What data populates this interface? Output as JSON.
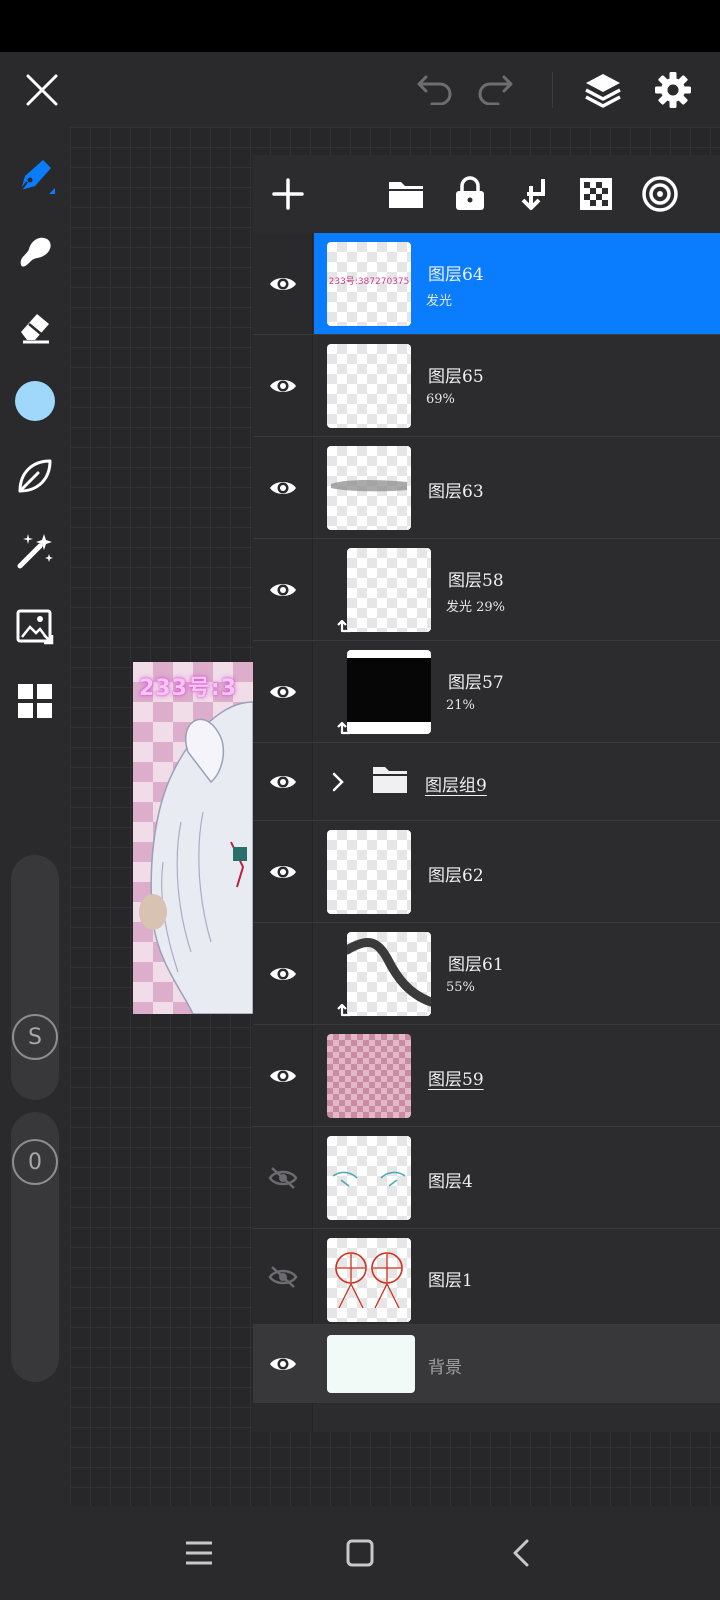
{
  "top_bar": {
    "close_icon": "close-icon",
    "undo_icon": "undo-icon",
    "redo_icon": "redo-icon",
    "layers_icon": "layers-icon",
    "settings_icon": "gear-icon"
  },
  "tools": [
    "pen-icon",
    "smudge-icon",
    "eraser-icon",
    "color-swatch",
    "leaf-icon",
    "magic-wand-icon",
    "image-import-icon",
    "grid-icon"
  ],
  "colors": {
    "accent": "#0a7dff",
    "current_color": "#9fd8fb"
  },
  "sliders": {
    "size_label": "S",
    "opacity_label": "0"
  },
  "artwork": {
    "text": "233号:3"
  },
  "layer_toolbar": [
    "add-layer-icon",
    "folder-icon",
    "lock-icon",
    "merge-down-icon",
    "transparency-icon",
    "target-icon"
  ],
  "layers": [
    {
      "name": "图层64",
      "sub": "发光",
      "thumb_text": "233号:387270375",
      "visible": true,
      "selected": true
    },
    {
      "name": "图层65",
      "sub": "69%",
      "visible": true
    },
    {
      "name": "图层63",
      "sub": "",
      "visible": true
    },
    {
      "name": "图层58",
      "sub": "发光 29%",
      "visible": true,
      "clipped": true
    },
    {
      "name": "图层57",
      "sub": "21%",
      "visible": true,
      "clipped": true
    },
    {
      "name": "图层组9",
      "sub": "",
      "visible": true,
      "group": true
    },
    {
      "name": "图层62",
      "sub": "",
      "visible": true
    },
    {
      "name": "图层61",
      "sub": "55%",
      "visible": true,
      "clipped": true
    },
    {
      "name": "图层59",
      "sub": "",
      "visible": true
    },
    {
      "name": "图层4",
      "sub": "",
      "visible": false
    },
    {
      "name": "图层1",
      "sub": "",
      "visible": false
    },
    {
      "name": "背景",
      "sub": "",
      "visible": true,
      "background": true
    }
  ],
  "nav": [
    "recent-apps-icon",
    "home-icon",
    "back-icon"
  ]
}
